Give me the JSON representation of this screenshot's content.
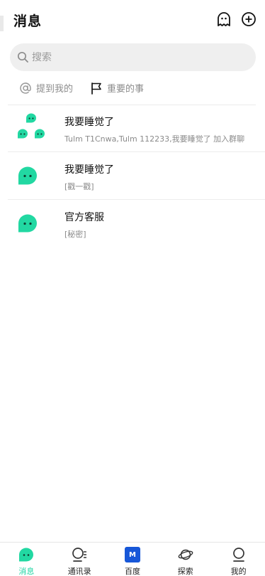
{
  "header": {
    "title": "消息"
  },
  "search": {
    "placeholder": "搜索"
  },
  "quick_filters": [
    {
      "label": "提到我的",
      "icon": "at-icon"
    },
    {
      "label": "重要的事",
      "icon": "flag-icon"
    }
  ],
  "conversations": [
    {
      "name": "我要睡觉了",
      "preview": "Tulm  T1Cnwa,Tulm  112233,我要睡觉了 加入群聊",
      "avatar": "group-avatar"
    },
    {
      "name": "我要睡觉了",
      "preview": "[戳一戳]",
      "avatar": "chat-bubble-avatar"
    },
    {
      "name": "官方客服",
      "preview": "[秘密]",
      "avatar": "chat-bubble-avatar"
    }
  ],
  "tabbar": [
    {
      "label": "消息",
      "icon": "message-icon",
      "active": true
    },
    {
      "label": "通讯录",
      "icon": "contacts-icon",
      "active": false
    },
    {
      "label": "百度",
      "icon": "baidu-icon",
      "badge_letter": "M",
      "active": false
    },
    {
      "label": "探索",
      "icon": "planet-icon",
      "active": false
    },
    {
      "label": "我的",
      "icon": "profile-icon",
      "active": false
    }
  ],
  "colors": {
    "accent": "#1ed4a3",
    "avatar_green": "#22d8a2",
    "baidu_blue": "#1757d8"
  }
}
